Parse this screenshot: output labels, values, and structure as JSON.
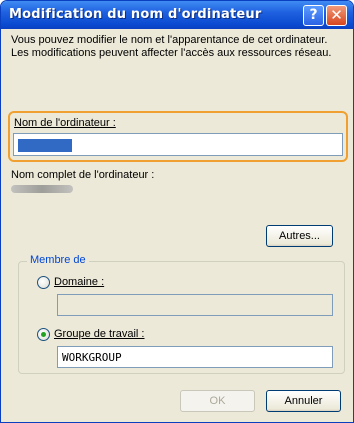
{
  "window": {
    "title": "Modification du nom d'ordinateur",
    "help_glyph": "?",
    "close_glyph": "✕"
  },
  "description": "Vous pouvez modifier le nom et l'apparentance de cet ordinateur. Les modifications peuvent affecter l'accès aux ressources réseau.",
  "computer_name": {
    "label": "Nom de l'ordinateur :",
    "value_obscured": true
  },
  "full_name": {
    "label": "Nom complet de l'ordinateur :",
    "value_obscured": true
  },
  "more_button": "Autres...",
  "member_of": {
    "legend": "Membre de",
    "domain_label": "Domaine :",
    "domain_value": "",
    "workgroup_label": "Groupe de travail :",
    "workgroup_value": "WORKGROUP",
    "selected": "workgroup"
  },
  "buttons": {
    "ok": "OK",
    "cancel": "Annuler"
  },
  "colors": {
    "titlebar": "#0a4ad0",
    "dialog_bg": "#ece9d8",
    "focus_highlight": "#f0a030",
    "selection": "#316ac5",
    "group_legend": "#0046d5",
    "radio_dot": "#21a121"
  },
  "icons": [
    "help-icon",
    "close-icon"
  ]
}
